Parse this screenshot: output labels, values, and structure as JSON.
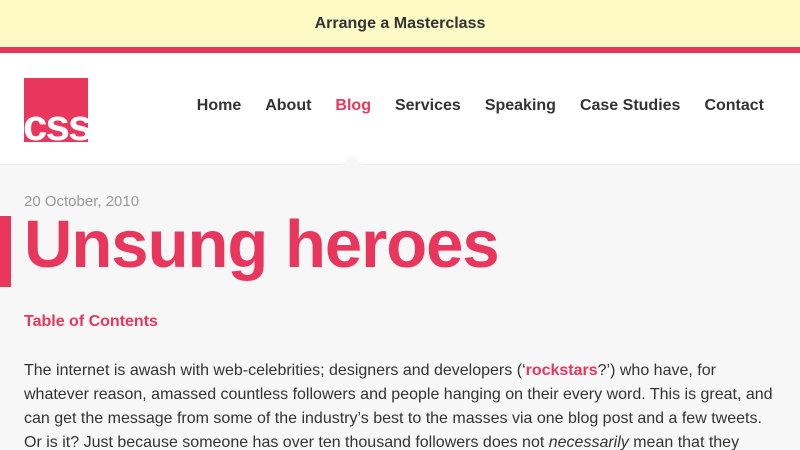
{
  "banner": {
    "label": "Arrange a Masterclass"
  },
  "brand": {
    "logo_text": "css"
  },
  "nav": {
    "items": [
      {
        "label": "Home"
      },
      {
        "label": "About"
      },
      {
        "label": "Blog"
      },
      {
        "label": "Services"
      },
      {
        "label": "Speaking"
      },
      {
        "label": "Case Studies"
      },
      {
        "label": "Contact"
      }
    ],
    "active": "Blog"
  },
  "article": {
    "date": "20 October, 2010",
    "title": "Unsung heroes",
    "toc_label": "Table of Contents",
    "para": {
      "p1": "The internet is awash with web-celebrities; designers and developers (‘",
      "link": "rockstars",
      "p2": "?’) who have, for whatever reason, amassed countless followers and people hanging on their every word. This is great, and can get the message from some of the industry’s best to the masses via one blog post and a few tweets. Or is it? Just because someone has over ten thousand followers does not ",
      "em": "necessarily",
      "p3": " mean that they"
    }
  },
  "colors": {
    "accent": "#e8365d",
    "banner_bg": "#fdfac5",
    "page_bg": "#f7f7f7"
  }
}
